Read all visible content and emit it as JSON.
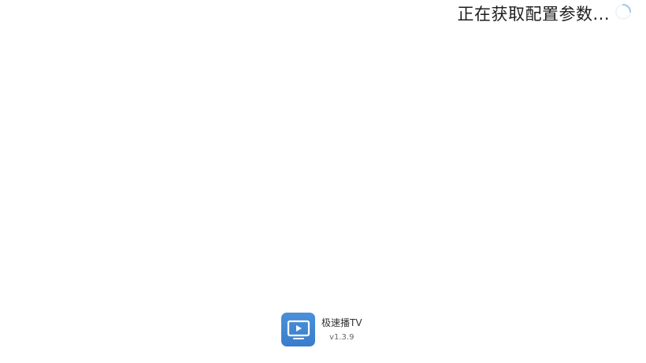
{
  "status": {
    "loading_text": "正在获取配置参数...",
    "spinner_icon": "loading-spinner-icon"
  },
  "app": {
    "icon": "tv-play-icon",
    "name": "极速播TV",
    "version": "v1.3.9",
    "icon_color": "#4a90d9"
  },
  "colors": {
    "background": "#ffffff",
    "status_text": "#1e1e1e",
    "spinner": "#9cc7f0"
  }
}
